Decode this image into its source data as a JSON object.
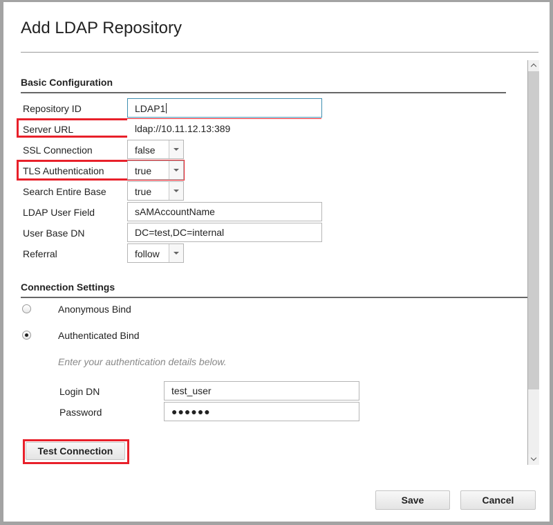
{
  "dialog": {
    "title": "Add LDAP Repository"
  },
  "basic": {
    "section_title": "Basic Configuration",
    "fields": {
      "repository_id": {
        "label": "Repository ID",
        "value": "LDAP1"
      },
      "server_url": {
        "label": "Server URL",
        "value": "ldap://10.11.12.13:389"
      },
      "ssl_connection": {
        "label": "SSL Connection",
        "value": "false"
      },
      "tls_authentication": {
        "label": "TLS Authentication",
        "value": "true"
      },
      "search_entire_base": {
        "label": "Search Entire Base",
        "value": "true"
      },
      "ldap_user_field": {
        "label": "LDAP User Field",
        "value": "sAMAccountName"
      },
      "user_base_dn": {
        "label": "User Base DN",
        "value": "DC=test,DC=internal"
      },
      "referral": {
        "label": "Referral",
        "value": "follow"
      }
    }
  },
  "connection": {
    "section_title": "Connection Settings",
    "options": [
      {
        "label": "Anonymous Bind",
        "checked": false
      },
      {
        "label": "Authenticated Bind",
        "checked": true
      }
    ],
    "hint": "Enter your authentication details below.",
    "login_dn": {
      "label": "Login DN",
      "value": "test_user"
    },
    "password": {
      "label": "Password",
      "value": "●●●●●●"
    },
    "test_button": "Test Connection"
  },
  "footer": {
    "save_label": "Save",
    "cancel_label": "Cancel"
  },
  "colors": {
    "highlight": "#e8202a",
    "focus_border": "#3e8eb0"
  }
}
